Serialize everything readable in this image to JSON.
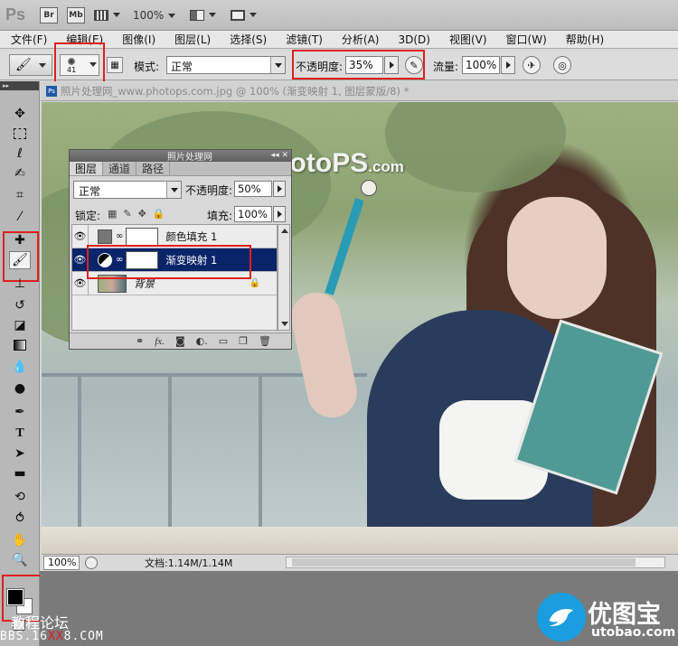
{
  "app": {
    "logo": "Ps",
    "bridge_btn": "Br",
    "minibridge_btn": "Mb",
    "zoom": "100%"
  },
  "menu": [
    "文件(F)",
    "编辑(E)",
    "图像(I)",
    "图层(L)",
    "选择(S)",
    "滤镜(T)",
    "分析(A)",
    "3D(D)",
    "视图(V)",
    "窗口(W)",
    "帮助(H)"
  ],
  "options": {
    "brush_size": "41",
    "mode_label": "模式:",
    "mode_value": "正常",
    "opacity_label": "不透明度:",
    "opacity_value": "35%",
    "flow_label": "流量:",
    "flow_value": "100%"
  },
  "document": {
    "tab_title": "照片处理网_www.photops.com.jpg @ 100% (渐变映射 1, 图层蒙版/8) *",
    "watermark_main": "www.PhotoPS",
    "watermark_suffix": ".com",
    "status_zoom": "100%",
    "status_doc": "文档:1.14M/1.14M"
  },
  "layers_panel": {
    "title": "照片处理网",
    "tabs": [
      "图层",
      "通道",
      "路径"
    ],
    "blend_mode": "正常",
    "opacity_label": "不透明度:",
    "opacity_value": "50%",
    "lock_label": "锁定:",
    "fill_label": "填充:",
    "fill_value": "100%",
    "layers": [
      {
        "name": "颜色填充 1",
        "selected": false
      },
      {
        "name": "渐变映射 1",
        "selected": true
      },
      {
        "name": "背景",
        "selected": false
      }
    ]
  },
  "footer": {
    "forum_text": "教程论坛",
    "url_a": "BBS.16",
    "url_b": "XX",
    "url_c": "8.COM",
    "logo_cn": "优图宝",
    "logo_en": "utobao.com"
  },
  "colors": {
    "highlight_red": "#e0201e",
    "selected_layer": "#0a246a",
    "logo_blue": "#1b9ee0"
  }
}
